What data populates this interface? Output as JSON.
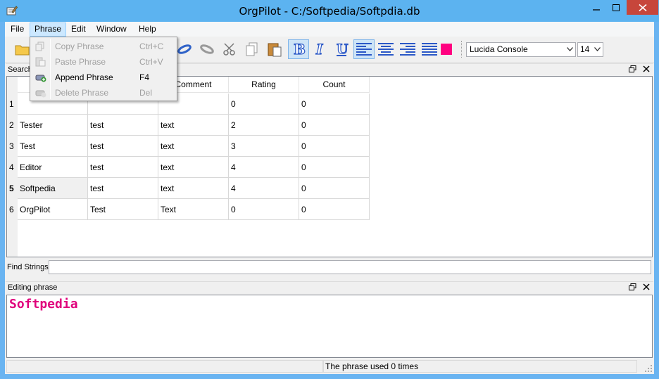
{
  "window": {
    "title": "OrgPilot - C:/Softpedia/Softpdia.db"
  },
  "menubar": {
    "items": [
      "File",
      "Phrase",
      "Edit",
      "Window",
      "Help"
    ]
  },
  "phrase_menu": {
    "items": [
      {
        "label": "Copy Phrase",
        "shortcut": "Ctrl+C",
        "enabled": false
      },
      {
        "label": "Paste Phrase",
        "shortcut": "Ctrl+V",
        "enabled": false
      },
      {
        "label": "Append Phrase",
        "shortcut": "F4",
        "enabled": true
      },
      {
        "label": "Delete Phrase",
        "shortcut": "Del",
        "enabled": false
      }
    ]
  },
  "toolbar": {
    "font": "Lucida Console",
    "size": "14",
    "color_swatch": "#ff0080"
  },
  "search_dock": {
    "title": "Search"
  },
  "table": {
    "columns": [
      "",
      "",
      "Comment",
      "Rating",
      "Count"
    ],
    "rows": [
      {
        "num": "1",
        "cells": [
          "",
          "",
          "",
          "0",
          "0"
        ]
      },
      {
        "num": "2",
        "cells": [
          "Tester",
          "test",
          "text",
          "2",
          "0"
        ]
      },
      {
        "num": "3",
        "cells": [
          "Test",
          "test",
          "text",
          "3",
          "0"
        ]
      },
      {
        "num": "4",
        "cells": [
          "Editor",
          "test",
          "text",
          "4",
          "0"
        ]
      },
      {
        "num": "5",
        "cells": [
          "Softpedia",
          "test",
          "text",
          "4",
          "0"
        ]
      },
      {
        "num": "6",
        "cells": [
          "OrgPilot",
          "Test",
          "Text",
          "0",
          "0"
        ]
      }
    ]
  },
  "find": {
    "label": "Find Strings",
    "value": ""
  },
  "editor_dock": {
    "title": "Editing phrase",
    "text": "Softpedia",
    "text_color": "#e0007c"
  },
  "status": {
    "message": "The phrase used 0 times"
  }
}
